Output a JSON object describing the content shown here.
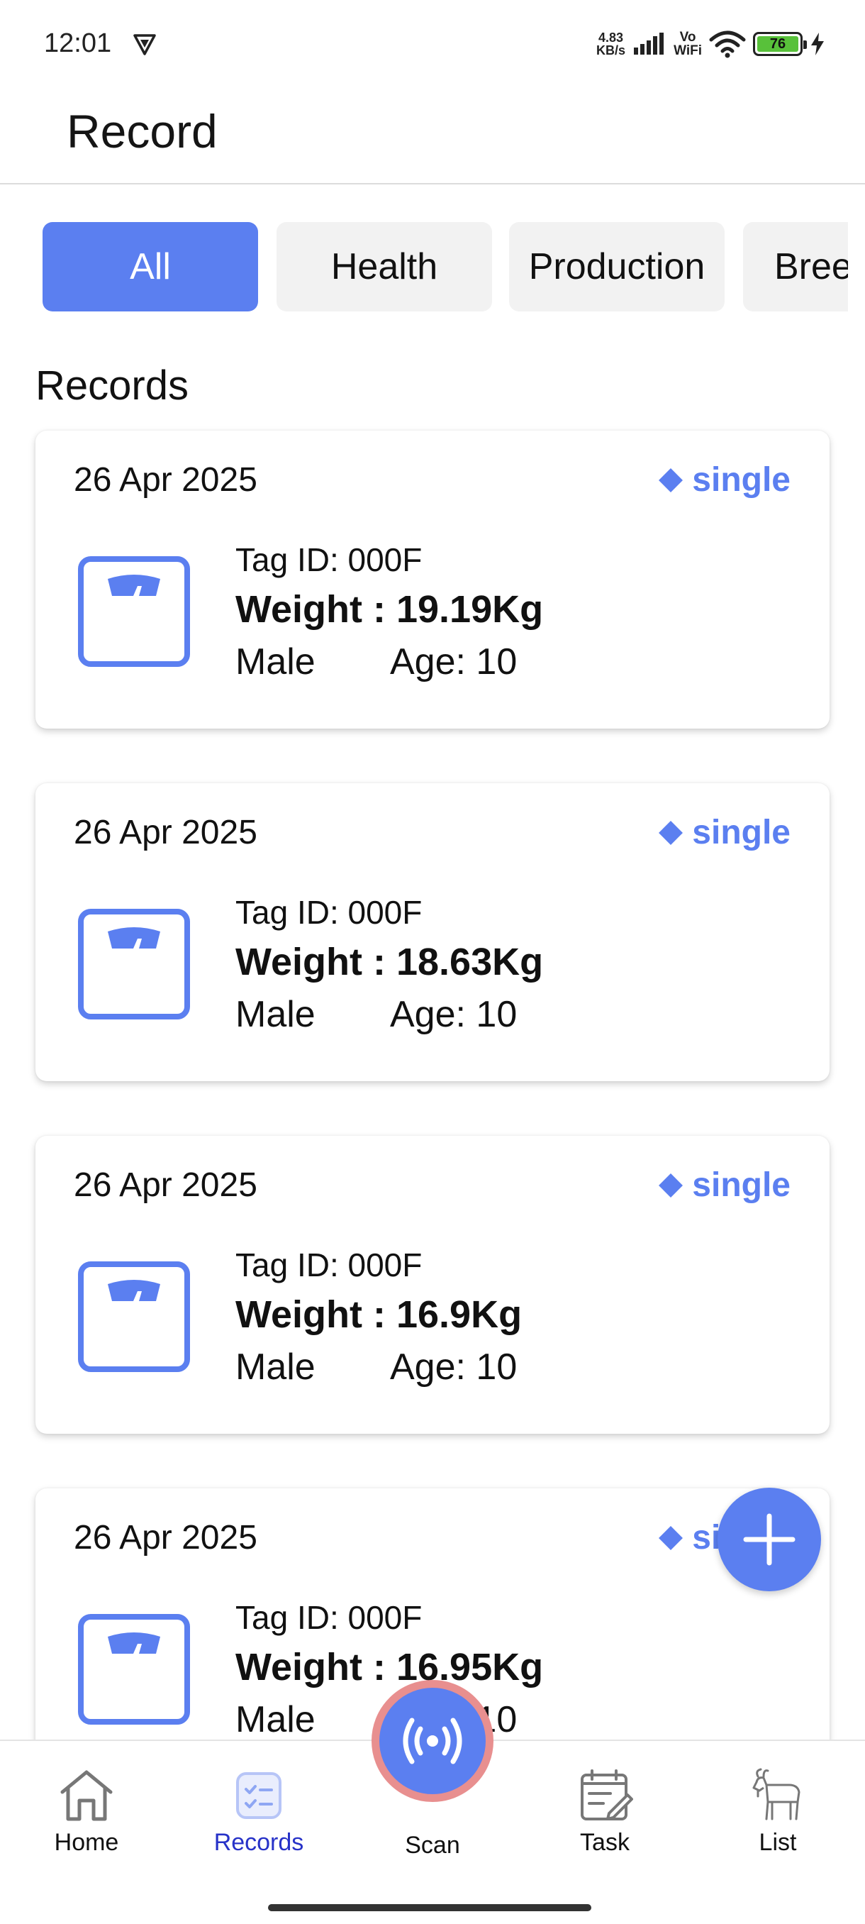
{
  "status_bar": {
    "time": "12:01",
    "net_speed_value": "4.83",
    "net_speed_unit": "KB/s",
    "volte_top": "Vo",
    "volte_bottom": "WiFi",
    "battery": "76"
  },
  "header": {
    "title": "Record"
  },
  "filters": [
    {
      "label": "All",
      "active": true
    },
    {
      "label": "Health",
      "active": false
    },
    {
      "label": "Production",
      "active": false
    },
    {
      "label": "Bree",
      "active": false
    }
  ],
  "section_title": "Records",
  "records": [
    {
      "date": "26 Apr 2025",
      "type": "single",
      "tag": "Tag ID: 000F",
      "weight": "Weight : 19.19Kg",
      "sex": "Male",
      "age": "Age: 10"
    },
    {
      "date": "26 Apr 2025",
      "type": "single",
      "tag": "Tag ID: 000F",
      "weight": "Weight : 18.63Kg",
      "sex": "Male",
      "age": "Age: 10"
    },
    {
      "date": "26 Apr 2025",
      "type": "single",
      "tag": "Tag ID: 000F",
      "weight": "Weight : 16.9Kg",
      "sex": "Male",
      "age": "Age: 10"
    },
    {
      "date": "26 Apr 2025",
      "type": "single",
      "tag": "Tag ID: 000F",
      "weight": "Weight : 16.95Kg",
      "sex": "Male",
      "age": "Age: 10"
    }
  ],
  "bottom_nav": {
    "home": "Home",
    "records": "Records",
    "scan": "Scan",
    "task": "Task",
    "list": "List"
  },
  "colors": {
    "accent": "#5b7ff0",
    "active_nav": "#2732c8",
    "scan_ring": "#e88f8f",
    "battery": "#58c13a"
  },
  "icons": {
    "fab": "plus-icon",
    "scan": "broadcast-icon",
    "record": "scale-icon",
    "type": "diamond-icon"
  }
}
